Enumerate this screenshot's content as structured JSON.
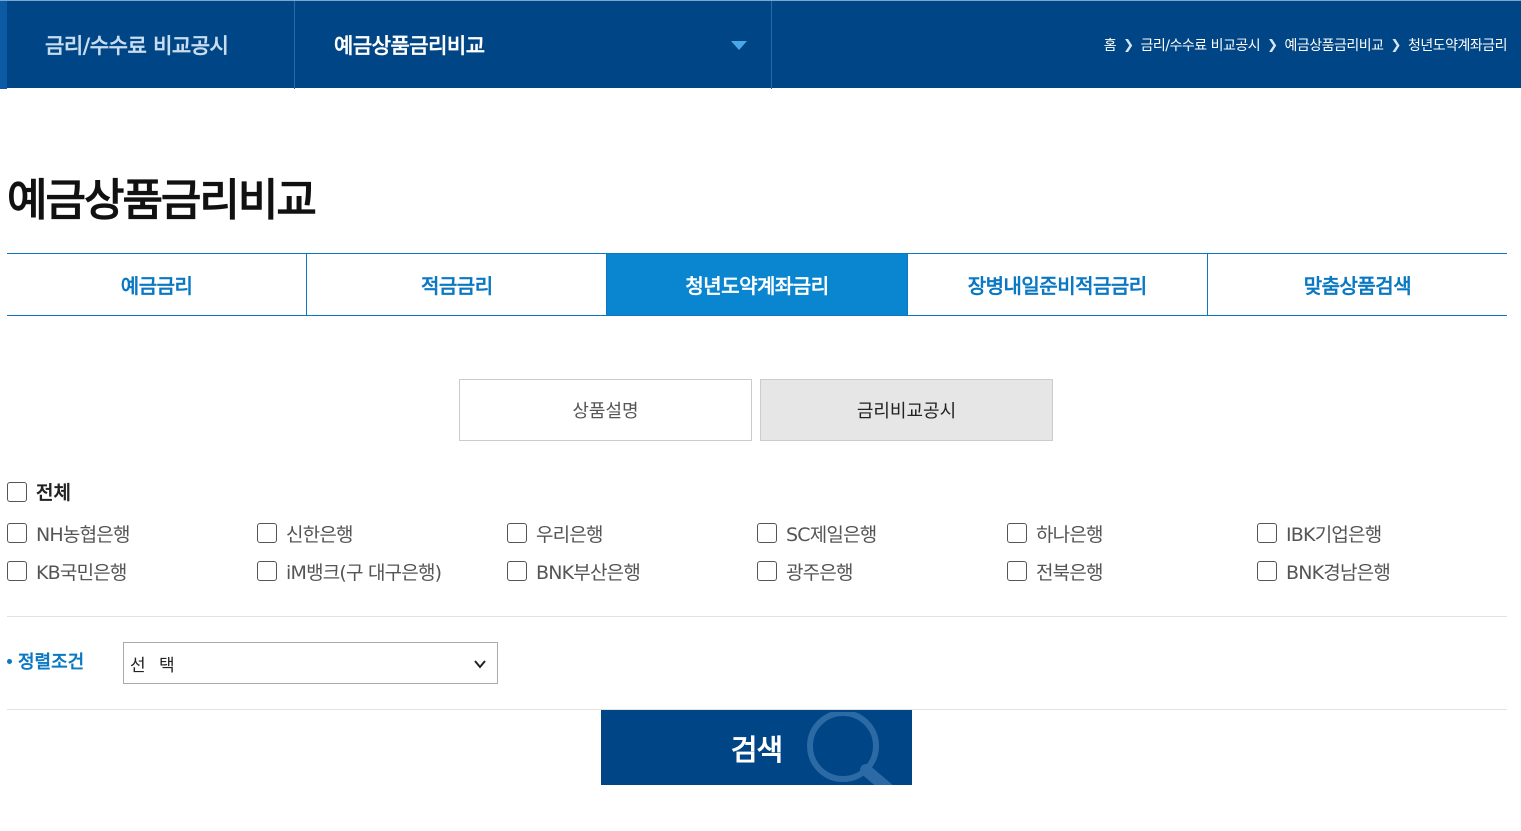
{
  "header": {
    "category": "금리/수수료 비교공시",
    "section": "예금상품금리비교",
    "breadcrumb": [
      "홈",
      "금리/수수료 비교공시",
      "예금상품금리비교",
      "청년도약계좌금리"
    ]
  },
  "page": {
    "title": "예금상품금리비교"
  },
  "tabs": [
    {
      "label": "예금금리",
      "active": false
    },
    {
      "label": "적금금리",
      "active": false
    },
    {
      "label": "청년도약계좌금리",
      "active": true
    },
    {
      "label": "장병내일준비적금금리",
      "active": false
    },
    {
      "label": "맞춤상품검색",
      "active": false
    }
  ],
  "subtabs": [
    {
      "label": "상품설명",
      "active": false
    },
    {
      "label": "금리비교공시",
      "active": true
    }
  ],
  "filters": {
    "all_label": "전체",
    "banks": [
      [
        "NH농협은행",
        "신한은행",
        "우리은행",
        "SC제일은행",
        "하나은행",
        "IBK기업은행"
      ],
      [
        "KB국민은행",
        "iM뱅크(구 대구은행)",
        "BNK부산은행",
        "광주은행",
        "전북은행",
        "BNK경남은행"
      ]
    ]
  },
  "sort": {
    "label": "정렬조건",
    "value": "선 택"
  },
  "search": {
    "label": "검색"
  },
  "colors": {
    "navy": "#004585",
    "accent": "#0a78c2",
    "active_tab": "#0a85d0"
  },
  "icons": [
    "chevron-right-icon",
    "triangle-down-icon",
    "chevron-down-icon",
    "magnifier-icon"
  ]
}
